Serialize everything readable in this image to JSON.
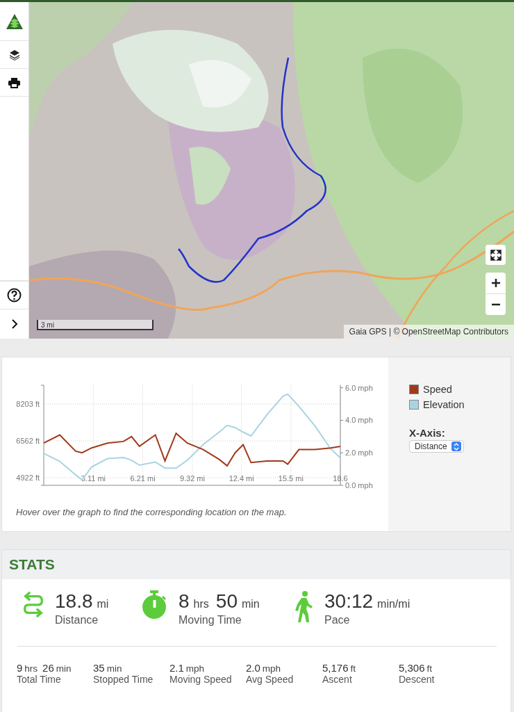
{
  "map": {
    "kind": "picture",
    "sidebar": [
      {
        "kind": "logo"
      },
      {
        "kind": "layers"
      },
      {
        "kind": "print"
      },
      {
        "kind": "spacer"
      },
      {
        "kind": "help"
      },
      {
        "kind": "expand"
      }
    ],
    "scale": "3 mi",
    "attribution": "Gaia GPS | © OpenStreetMap Contributors"
  },
  "chart": {
    "x_axis_label": "X-Axis:",
    "x_axis_value": "Distance",
    "caption": "Hover over the graph to find the corresponding location on the map.",
    "chart_data": {
      "type": "line",
      "grid": true,
      "xlim": [
        0,
        18.6
      ],
      "ylim": [
        4582,
        9038
      ],
      "y2lim": [
        0,
        6.16
      ],
      "xticks": [
        {
          "value": 3.11,
          "label": "3.11 mi"
        },
        {
          "value": 6.21,
          "label": "6.21 mi"
        },
        {
          "value": 9.32,
          "label": "9.32 mi"
        },
        {
          "value": 12.4,
          "label": "12.4 mi"
        },
        {
          "value": 15.5,
          "label": "15.5 mi"
        },
        {
          "value": 18.6,
          "label": "18.6"
        }
      ],
      "yticks": [
        {
          "value": 4922,
          "label": "4922 ft"
        },
        {
          "value": 6562,
          "label": "6562 ft"
        },
        {
          "value": 8203,
          "label": "8203 ft"
        }
      ],
      "y2ticks": [
        {
          "value": 0,
          "label": "0.0 mph"
        },
        {
          "value": 2,
          "label": "2.0 mph"
        },
        {
          "value": 4,
          "label": "4.0 mph"
        },
        {
          "value": 6,
          "label": "6.0 mph"
        }
      ],
      "x": [
        0,
        1,
        2,
        2.4,
        3,
        4,
        5,
        5.5,
        6,
        7,
        7.6,
        8.3,
        9,
        10,
        11,
        11.5,
        12,
        12.5,
        13,
        14,
        15,
        15.3,
        16,
        17,
        18,
        18.6
      ],
      "series": [
        {
          "name": "Speed",
          "color": "#a0391a",
          "axis": "y2",
          "values": [
            2.6,
            3.1,
            2.1,
            2.0,
            2.3,
            2.6,
            2.7,
            3.0,
            2.4,
            3.1,
            1.5,
            3.2,
            2.6,
            2.2,
            1.6,
            1.2,
            2.0,
            2.5,
            1.4,
            1.5,
            1.5,
            1.3,
            2.2,
            2.2,
            2.3,
            2.4
          ]
        },
        {
          "name": "Elevation",
          "color": "#a8d4e2",
          "values": [
            6000,
            5650,
            5050,
            4820,
            5400,
            5770,
            5820,
            5700,
            5480,
            5620,
            5350,
            5350,
            5700,
            6400,
            6950,
            7250,
            7150,
            6950,
            6780,
            7730,
            8550,
            8640,
            8100,
            7230,
            6200,
            5800
          ]
        }
      ]
    }
  },
  "stats": {
    "title": "STATS",
    "main": [
      {
        "kind": "distance",
        "parts": [
          {
            "value": "18.8",
            "unit": "mi"
          }
        ],
        "label": "Distance"
      },
      {
        "kind": "timer",
        "parts": [
          {
            "value": "8",
            "unit": "hrs"
          },
          {
            "value": "50",
            "unit": "min"
          }
        ],
        "label": "Moving Time"
      },
      {
        "kind": "walker",
        "parts": [
          {
            "value": "30:12",
            "unit": "min/mi"
          }
        ],
        "label": "Pace"
      }
    ],
    "secondary": [
      {
        "parts": [
          {
            "value": "9",
            "unit": "hrs"
          },
          {
            "value": "26",
            "unit": "min"
          }
        ],
        "label": "Total Time"
      },
      {
        "parts": [
          {
            "value": "35",
            "unit": "min"
          }
        ],
        "label": "Stopped Time"
      },
      {
        "parts": [
          {
            "value": "2.1",
            "unit": "mph"
          }
        ],
        "label": "Moving Speed"
      },
      {
        "parts": [
          {
            "value": "2.0",
            "unit": "mph"
          }
        ],
        "label": "Avg Speed"
      },
      {
        "parts": [
          {
            "value": "5,176",
            "unit": "ft"
          }
        ],
        "label": "Ascent"
      },
      {
        "parts": [
          {
            "value": "5,306",
            "unit": "ft"
          }
        ],
        "label": "Descent"
      }
    ]
  }
}
